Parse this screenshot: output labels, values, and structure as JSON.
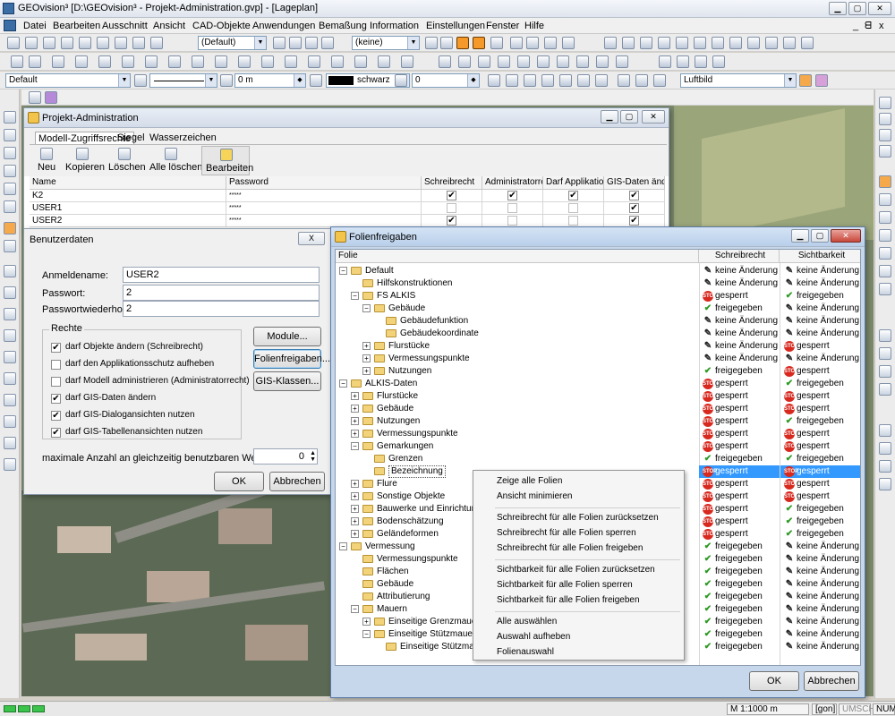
{
  "app": {
    "title": "GEOvision³  [D:\\GEOvision³ - Projekt-Administration.gvp] - [Lageplan]"
  },
  "menu": [
    "Datei",
    "Bearbeiten",
    "Ausschnitt",
    "Ansicht",
    "CAD-Objekte",
    "Anwendungen",
    "Bemaßung",
    "Information",
    "Einstellungen",
    "Fenster",
    "Hilfe"
  ],
  "toolbar": {
    "style_combo": "(Default)",
    "layer_combo": "(keine)",
    "layer_default": "Default",
    "width_combo": "0 m",
    "color_label": "schwarz",
    "value_combo": "0",
    "map_combo": "Luftbild"
  },
  "projadmin": {
    "title": "Projekt-Administration",
    "tabs": [
      "Modell-Zugriffsrechte",
      "Siegel",
      "Wasserzeichen"
    ],
    "buttons": [
      "Neu",
      "Kopieren",
      "Löschen",
      "Alle löschen",
      "Bearbeiten"
    ],
    "columns": [
      "Name",
      "Password",
      "Schreibrecht",
      "Administratorrech",
      "Darf Applikations",
      "GIS-Daten änder"
    ],
    "rows": [
      {
        "name": "K2",
        "pw": "*****",
        "c": [
          true,
          true,
          true,
          true
        ]
      },
      {
        "name": "USER1",
        "pw": "*****",
        "c": [
          false,
          false,
          false,
          true
        ]
      },
      {
        "name": "USER2",
        "pw": "*****",
        "c": [
          true,
          false,
          false,
          true
        ]
      }
    ]
  },
  "benutzer": {
    "title": "Benutzerdaten",
    "close": "X",
    "fields": [
      {
        "label": "Anmeldename:",
        "value": "USER2"
      },
      {
        "label": "Passwort:",
        "value": "2"
      },
      {
        "label": "Passwortwiederholung:",
        "value": "2"
      }
    ],
    "rechte_label": "Rechte",
    "rights": [
      {
        "label": "darf Objekte ändern (Schreibrecht)",
        "checked": true
      },
      {
        "label": "darf den Applikationsschutz aufheben",
        "checked": false
      },
      {
        "label": "darf Modell administrieren (Administratorrecht)",
        "checked": false
      },
      {
        "label": "darf GIS-Daten ändern",
        "checked": true
      },
      {
        "label": "darf GIS-Dialogansichten nutzen",
        "checked": true
      },
      {
        "label": "darf GIS-Tabellenansichten nutzen",
        "checked": true
      }
    ],
    "side_buttons": [
      "Module...",
      "Folienfreigaben...",
      "GIS-Klassen..."
    ],
    "lizenz_label": "maximale Anzahl an gleichzeitig benutzbaren Web-Lizenzen:",
    "lizenz_value": "0",
    "ok": "OK",
    "cancel": "Abbrechen"
  },
  "folien": {
    "title": "Folienfreigaben",
    "col_folie": "Folie",
    "col_schreib": "Schreibrecht",
    "col_sicht": "Sichtbarkeit",
    "rows": [
      {
        "name": "Default",
        "lvl": 0,
        "exp": "−",
        "s": "keine Änderung",
        "v": "keine Änderung",
        "si": "pen",
        "vi": "pen"
      },
      {
        "name": "Hilfskonstruktionen",
        "lvl": 1,
        "exp": "",
        "s": "keine Änderung",
        "v": "keine Änderung",
        "si": "pen",
        "vi": "pen"
      },
      {
        "name": "FS ALKIS",
        "lvl": 1,
        "exp": "−",
        "s": "gesperrt",
        "v": "freigegeben",
        "si": "stop",
        "vi": "chk"
      },
      {
        "name": "Gebäude",
        "lvl": 2,
        "exp": "−",
        "s": "freigegeben",
        "v": "keine Änderung",
        "si": "chk",
        "vi": "pen"
      },
      {
        "name": "Gebäudefunktion",
        "lvl": 3,
        "exp": "",
        "s": "keine Änderung",
        "v": "keine Änderung",
        "si": "pen",
        "vi": "pen"
      },
      {
        "name": "Gebäudekoordinate",
        "lvl": 3,
        "exp": "",
        "s": "keine Änderung",
        "v": "keine Änderung",
        "si": "pen",
        "vi": "pen"
      },
      {
        "name": "Flurstücke",
        "lvl": 2,
        "exp": "+",
        "s": "keine Änderung",
        "v": "gesperrt",
        "si": "pen",
        "vi": "stop"
      },
      {
        "name": "Vermessungspunkte",
        "lvl": 2,
        "exp": "+",
        "s": "keine Änderung",
        "v": "keine Änderung",
        "si": "pen",
        "vi": "pen"
      },
      {
        "name": "Nutzungen",
        "lvl": 2,
        "exp": "+",
        "s": "freigegeben",
        "v": "gesperrt",
        "si": "chk",
        "vi": "stop"
      },
      {
        "name": "ALKIS-Daten",
        "lvl": 0,
        "exp": "−",
        "s": "gesperrt",
        "v": "freigegeben",
        "si": "stop",
        "vi": "chk"
      },
      {
        "name": "Flurstücke",
        "lvl": 1,
        "exp": "+",
        "s": "gesperrt",
        "v": "gesperrt",
        "si": "stop",
        "vi": "stop"
      },
      {
        "name": "Gebäude",
        "lvl": 1,
        "exp": "+",
        "s": "gesperrt",
        "v": "gesperrt",
        "si": "stop",
        "vi": "stop"
      },
      {
        "name": "Nutzungen",
        "lvl": 1,
        "exp": "+",
        "s": "gesperrt",
        "v": "freigegeben",
        "si": "stop",
        "vi": "chk"
      },
      {
        "name": "Vermessungspunkte",
        "lvl": 1,
        "exp": "+",
        "s": "gesperrt",
        "v": "gesperrt",
        "si": "stop",
        "vi": "stop"
      },
      {
        "name": "Gemarkungen",
        "lvl": 1,
        "exp": "−",
        "s": "gesperrt",
        "v": "gesperrt",
        "si": "stop",
        "vi": "stop"
      },
      {
        "name": "Grenzen",
        "lvl": 2,
        "exp": "",
        "s": "freigegeben",
        "v": "freigegeben",
        "si": "chk",
        "vi": "chk"
      },
      {
        "name": "Bezeichnung",
        "lvl": 2,
        "exp": "",
        "s": "gesperrt",
        "v": "gesperrt",
        "si": "stop",
        "vi": "stop",
        "sel": true
      },
      {
        "name": "Flure",
        "lvl": 1,
        "exp": "+",
        "s": "gesperrt",
        "v": "gesperrt",
        "si": "stop",
        "vi": "stop"
      },
      {
        "name": "Sonstige Objekte",
        "lvl": 1,
        "exp": "+",
        "s": "gesperrt",
        "v": "gesperrt",
        "si": "stop",
        "vi": "stop"
      },
      {
        "name": "Bauwerke und Einrichtung",
        "lvl": 1,
        "exp": "+",
        "s": "gesperrt",
        "v": "freigegeben",
        "si": "stop",
        "vi": "chk"
      },
      {
        "name": "Bodenschätzung",
        "lvl": 1,
        "exp": "+",
        "s": "gesperrt",
        "v": "freigegeben",
        "si": "stop",
        "vi": "chk"
      },
      {
        "name": "Geländeformen",
        "lvl": 1,
        "exp": "+",
        "s": "gesperrt",
        "v": "freigegeben",
        "si": "stop",
        "vi": "chk"
      },
      {
        "name": "Vermessung",
        "lvl": 0,
        "exp": "−",
        "s": "freigegeben",
        "v": "keine Änderung",
        "si": "chk",
        "vi": "pen"
      },
      {
        "name": "Vermessungspunkte",
        "lvl": 1,
        "exp": "",
        "s": "freigegeben",
        "v": "keine Änderung",
        "si": "chk",
        "vi": "pen"
      },
      {
        "name": "Flächen",
        "lvl": 1,
        "exp": "",
        "s": "freigegeben",
        "v": "keine Änderung",
        "si": "chk",
        "vi": "pen"
      },
      {
        "name": "Gebäude",
        "lvl": 1,
        "exp": "",
        "s": "freigegeben",
        "v": "keine Änderung",
        "si": "chk",
        "vi": "pen"
      },
      {
        "name": "Attributierung",
        "lvl": 1,
        "exp": "",
        "s": "freigegeben",
        "v": "keine Änderung",
        "si": "chk",
        "vi": "pen"
      },
      {
        "name": "Mauern",
        "lvl": 1,
        "exp": "−",
        "s": "freigegeben",
        "v": "keine Änderung",
        "si": "chk",
        "vi": "pen"
      },
      {
        "name": "Einseitige Grenzmauer",
        "lvl": 2,
        "exp": "+",
        "s": "freigegeben",
        "v": "keine Änderung",
        "si": "chk",
        "vi": "pen"
      },
      {
        "name": "Einseitige Stützmauer",
        "lvl": 2,
        "exp": "−",
        "s": "freigegeben",
        "v": "keine Änderung",
        "si": "chk",
        "vi": "pen"
      },
      {
        "name": "Einseitige Stützmau",
        "lvl": 3,
        "exp": "",
        "s": "freigegeben",
        "v": "keine Änderung",
        "si": "chk",
        "vi": "pen"
      }
    ],
    "ok": "OK",
    "cancel": "Abbrechen"
  },
  "context_menu": [
    "Zeige alle Folien",
    "Ansicht minimieren",
    "Schreibrecht für alle Folien zurücksetzen",
    "Schreibrecht für alle Folien sperren",
    "Schreibrecht für alle Folien freigeben",
    "Sichtbarkeit für alle Folien zurücksetzen",
    "Sichtbarkeit für alle Folien sperren",
    "Sichtbarkeit für alle Folien freigeben",
    "Alle auswählen",
    "Auswahl aufheben",
    "Folienauswahl"
  ],
  "status": {
    "scale": "M 1:1000  m",
    "gon": "[gon]",
    "umsch": "UMSCH",
    "num": "NUM"
  },
  "colors": {
    "accent": "#3399ff",
    "selection": "#3a8ee6",
    "stop": "#d8291f",
    "ok_green": "#2d9a24"
  }
}
